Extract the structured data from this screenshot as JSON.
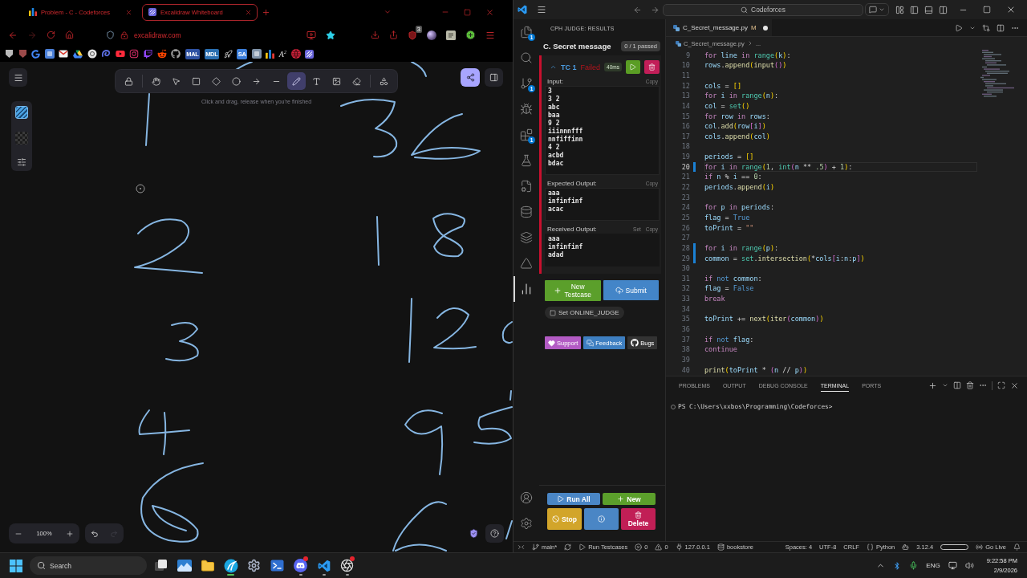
{
  "browser": {
    "tabs": [
      {
        "title": "Problem - C - Codeforces",
        "kind": "bars",
        "selected": false
      },
      {
        "title": "Excalidraw Whiteboard",
        "kind": "tile",
        "selected": true
      }
    ],
    "url": "excalidraw.com",
    "extension_badge": "3",
    "bookmarks": [
      {
        "kind": "pentagon",
        "color": "#b9b9b9"
      },
      {
        "kind": "pentagon",
        "color": "#9b4a4a"
      },
      {
        "kind": "google"
      },
      {
        "kind": "tile",
        "color": "#4a7fd8"
      },
      {
        "kind": "mail"
      },
      {
        "kind": "drive"
      },
      {
        "kind": "circle",
        "color": "#e4e4e4"
      },
      {
        "kind": "swirl",
        "color": "#5b6ee1"
      },
      {
        "kind": "youtube"
      },
      {
        "kind": "instagram"
      },
      {
        "kind": "twitch"
      },
      {
        "kind": "reddit"
      },
      {
        "kind": "github"
      },
      {
        "kind": "label",
        "color": "#2e51a2",
        "text": "MAL"
      },
      {
        "kind": "label",
        "color": "#2a6fb0",
        "text": "MDL"
      },
      {
        "kind": "rocket"
      },
      {
        "kind": "label",
        "color": "#3b7dd8",
        "text": "SA"
      },
      {
        "kind": "tile",
        "color": "#7f93a8"
      },
      {
        "kind": "bars"
      },
      {
        "kind": "glyph",
        "text": "A$^{2}$"
      },
      {
        "kind": "globe",
        "color": "#d2233c"
      },
      {
        "kind": "hatched"
      }
    ]
  },
  "whiteboard": {
    "tool_groups": [
      [
        {
          "kind": "lock",
          "selected": false
        }
      ],
      [
        {
          "kind": "hand",
          "selected": false
        },
        {
          "kind": "pointer",
          "selected": false
        },
        {
          "kind": "rectangle",
          "selected": false
        },
        {
          "kind": "diamond",
          "selected": false
        },
        {
          "kind": "ellipse",
          "selected": false
        },
        {
          "kind": "arrow",
          "selected": false
        },
        {
          "kind": "line",
          "selected": false
        },
        {
          "kind": "pencil",
          "selected": true
        },
        {
          "kind": "text",
          "selected": false
        },
        {
          "kind": "image",
          "selected": false
        },
        {
          "kind": "eraser",
          "selected": false
        }
      ],
      [
        {
          "kind": "shapes",
          "selected": false
        }
      ]
    ],
    "hint": "Click and drag, release when you're finished",
    "zoom": "100%",
    "history": [
      {
        "kind": "undo",
        "disabled": false
      },
      {
        "kind": "redo",
        "disabled": true
      }
    ]
  },
  "vscode": {
    "search": "Codeforces",
    "activity": [
      {
        "kind": "files",
        "badge": "1",
        "selected": false
      },
      {
        "kind": "search",
        "selected": false
      },
      {
        "kind": "scm",
        "badge": "1",
        "selected": false
      },
      {
        "kind": "debug",
        "selected": false
      },
      {
        "kind": "extensions",
        "badge": "1",
        "selected": false
      },
      {
        "kind": "testing",
        "selected": false
      },
      {
        "kind": "cph",
        "selected": false
      },
      {
        "kind": "database",
        "selected": false
      },
      {
        "kind": "layers",
        "selected": false
      },
      {
        "kind": "prism",
        "selected": false
      },
      {
        "kind": "chart",
        "selected": true
      }
    ],
    "cph": {
      "title": "CPH JUDGE: RESULTS",
      "problem": "C. Secret message",
      "summary": "0 / 1 passed",
      "testcases": [
        {
          "label": "TC 1",
          "status": "Failed",
          "time": "40ms",
          "failed": true,
          "expanded": true,
          "sections": [
            {
              "kind": "input",
              "title": "Input:",
              "actions": [
                "Copy"
              ],
              "lines": [
                "3",
                "3 2",
                "abc",
                "baa",
                "9 2",
                "iiinnnfff",
                "nnfiffinn",
                "4 2",
                "acbd",
                "bdac"
              ]
            },
            {
              "kind": "expected",
              "title": "Expected Output:",
              "actions": [
                "Copy"
              ],
              "lines": [
                "aaa",
                "infinfinf",
                "acac"
              ]
            },
            {
              "kind": "received",
              "title": "Received Output:",
              "actions": [
                "Set",
                "Copy"
              ],
              "lines": [
                "aaa",
                "infinfinf",
                "adad"
              ]
            }
          ]
        }
      ],
      "buttons": [
        {
          "kind": "new",
          "label": "New Testcase"
        },
        {
          "kind": "submit",
          "label": "Submit"
        }
      ],
      "online_judge": {
        "label": "Set ONLINE_JUDGE",
        "checked": false
      },
      "links": [
        {
          "kind": "support",
          "label": "Support"
        },
        {
          "kind": "feedback",
          "label": "Feedback"
        },
        {
          "kind": "bugs",
          "label": "Bugs"
        }
      ],
      "actions": [
        {
          "kind": "run-all",
          "label": "Run All"
        },
        {
          "kind": "new",
          "label": "New"
        },
        {
          "kind": "stop",
          "label": "Stop"
        },
        {
          "kind": "info"
        },
        {
          "kind": "delete",
          "label": "Delete"
        }
      ]
    },
    "editor": {
      "tab": {
        "title": "C_Secret_message.py",
        "status": "M",
        "dirty": true
      },
      "breadcrumb": {
        "file": "C_Secret_message.py",
        "rest": "..."
      },
      "lines": [
        {
          "number": "9",
          "current": false,
          "modified": false,
          "tokens": [
            {
              "text": "    for ",
              "kind": "kw"
            },
            {
              "text": "line ",
              "kind": "var"
            },
            {
              "text": "in ",
              "kind": "kw"
            },
            {
              "text": "range",
              "kind": "cls"
            },
            {
              "text": "(",
              "kind": "p1"
            },
            {
              "text": "k",
              "kind": "var"
            },
            {
              "text": ")",
              "kind": "p1"
            },
            {
              "text": ":",
              "kind": "op"
            }
          ]
        },
        {
          "number": "10",
          "current": false,
          "modified": false,
          "tokens": [
            {
              "text": "        rows",
              "kind": "var"
            },
            {
              "text": ".",
              "kind": "op"
            },
            {
              "text": "append",
              "kind": "fn"
            },
            {
              "text": "(",
              "kind": "p1"
            },
            {
              "text": "input",
              "kind": "fn"
            },
            {
              "text": "()",
              "kind": "p2"
            },
            {
              "text": ")",
              "kind": "p1"
            }
          ]
        },
        {
          "number": "11",
          "current": false,
          "modified": false
        },
        {
          "number": "12",
          "current": false,
          "modified": false,
          "tokens": [
            {
              "text": "    cols ",
              "kind": "var"
            },
            {
              "text": "= ",
              "kind": "op"
            },
            {
              "text": "[]",
              "kind": "p1"
            }
          ]
        },
        {
          "number": "13",
          "current": false,
          "modified": false,
          "tokens": [
            {
              "text": "    for ",
              "kind": "kw"
            },
            {
              "text": "i ",
              "kind": "var"
            },
            {
              "text": "in ",
              "kind": "kw"
            },
            {
              "text": "range",
              "kind": "cls"
            },
            {
              "text": "(",
              "kind": "p1"
            },
            {
              "text": "n",
              "kind": "var"
            },
            {
              "text": ")",
              "kind": "p1"
            },
            {
              "text": ":",
              "kind": "op"
            }
          ]
        },
        {
          "number": "14",
          "current": false,
          "modified": false,
          "tokens": [
            {
              "text": "        col ",
              "kind": "var"
            },
            {
              "text": "= ",
              "kind": "op"
            },
            {
              "text": "set",
              "kind": "cls"
            },
            {
              "text": "()",
              "kind": "p1"
            }
          ]
        },
        {
          "number": "15",
          "current": false,
          "modified": false,
          "tokens": [
            {
              "text": "        for ",
              "kind": "kw"
            },
            {
              "text": "row ",
              "kind": "var"
            },
            {
              "text": "in ",
              "kind": "kw"
            },
            {
              "text": "rows",
              "kind": "var"
            },
            {
              "text": ":",
              "kind": "op"
            }
          ]
        },
        {
          "number": "16",
          "current": false,
          "modified": false,
          "tokens": [
            {
              "text": "            col",
              "kind": "var"
            },
            {
              "text": ".",
              "kind": "op"
            },
            {
              "text": "add",
              "kind": "fn"
            },
            {
              "text": "(",
              "kind": "p1"
            },
            {
              "text": "row",
              "kind": "var"
            },
            {
              "text": "[",
              "kind": "p2"
            },
            {
              "text": "i",
              "kind": "var"
            },
            {
              "text": "]",
              "kind": "p2"
            },
            {
              "text": ")",
              "kind": "p1"
            }
          ]
        },
        {
          "number": "17",
          "current": false,
          "modified": false,
          "tokens": [
            {
              "text": "        cols",
              "kind": "var"
            },
            {
              "text": ".",
              "kind": "op"
            },
            {
              "text": "append",
              "kind": "fn"
            },
            {
              "text": "(",
              "kind": "p1"
            },
            {
              "text": "col",
              "kind": "var"
            },
            {
              "text": ")",
              "kind": "p1"
            }
          ]
        },
        {
          "number": "18",
          "current": false,
          "modified": false
        },
        {
          "number": "19",
          "current": false,
          "modified": false,
          "tokens": [
            {
              "text": "    periods ",
              "kind": "var"
            },
            {
              "text": "= ",
              "kind": "op"
            },
            {
              "text": "[]",
              "kind": "p1"
            }
          ]
        },
        {
          "number": "20",
          "current": true,
          "modified": true,
          "tokens": [
            {
              "text": "    for ",
              "kind": "kw"
            },
            {
              "text": "i ",
              "kind": "var"
            },
            {
              "text": "in ",
              "kind": "kw"
            },
            {
              "text": "range",
              "kind": "cls"
            },
            {
              "text": "(",
              "kind": "p1"
            },
            {
              "text": "1",
              "kind": "num"
            },
            {
              "text": ", ",
              "kind": "op"
            },
            {
              "text": "int",
              "kind": "cls"
            },
            {
              "text": "(",
              "kind": "p2"
            },
            {
              "text": "n ",
              "kind": "var"
            },
            {
              "text": "** ",
              "kind": "op"
            },
            {
              "text": ".5",
              "kind": "num"
            },
            {
              "text": ")",
              "kind": "p2"
            },
            {
              "text": " + ",
              "kind": "op"
            },
            {
              "text": "1",
              "kind": "num"
            },
            {
              "text": ")",
              "kind": "p1"
            },
            {
              "text": ":",
              "kind": "op"
            }
          ]
        },
        {
          "number": "21",
          "current": false,
          "modified": false,
          "tokens": [
            {
              "text": "        if ",
              "kind": "kw"
            },
            {
              "text": "n ",
              "kind": "var"
            },
            {
              "text": "% ",
              "kind": "op"
            },
            {
              "text": "i ",
              "kind": "var"
            },
            {
              "text": "== ",
              "kind": "op"
            },
            {
              "text": "0",
              "kind": "num"
            },
            {
              "text": ":",
              "kind": "op"
            }
          ]
        },
        {
          "number": "22",
          "current": false,
          "modified": false,
          "tokens": [
            {
              "text": "            periods",
              "kind": "var"
            },
            {
              "text": ".",
              "kind": "op"
            },
            {
              "text": "append",
              "kind": "fn"
            },
            {
              "text": "(",
              "kind": "p1"
            },
            {
              "text": "i",
              "kind": "var"
            },
            {
              "text": ")",
              "kind": "p1"
            }
          ]
        },
        {
          "number": "23",
          "current": false,
          "modified": false
        },
        {
          "number": "24",
          "current": false,
          "modified": false,
          "tokens": [
            {
              "text": "    for ",
              "kind": "kw"
            },
            {
              "text": "p ",
              "kind": "var"
            },
            {
              "text": "in ",
              "kind": "kw"
            },
            {
              "text": "periods",
              "kind": "var"
            },
            {
              "text": ":",
              "kind": "op"
            }
          ]
        },
        {
          "number": "25",
          "current": false,
          "modified": false,
          "tokens": [
            {
              "text": "        flag ",
              "kind": "var"
            },
            {
              "text": "= ",
              "kind": "op"
            },
            {
              "text": "True",
              "kind": "const"
            }
          ]
        },
        {
          "number": "26",
          "current": false,
          "modified": false,
          "tokens": [
            {
              "text": "        toPrint ",
              "kind": "var"
            },
            {
              "text": "= ",
              "kind": "op"
            },
            {
              "text": "\"\"",
              "kind": "str"
            }
          ]
        },
        {
          "number": "27",
          "current": false,
          "modified": false
        },
        {
          "number": "28",
          "current": false,
          "modified": true,
          "tokens": [
            {
              "text": "        for ",
              "kind": "kw"
            },
            {
              "text": "i ",
              "kind": "var"
            },
            {
              "text": "in ",
              "kind": "kw"
            },
            {
              "text": "range",
              "kind": "cls"
            },
            {
              "text": "(",
              "kind": "p1"
            },
            {
              "text": "p",
              "kind": "var"
            },
            {
              "text": ")",
              "kind": "p1"
            },
            {
              "text": ":",
              "kind": "op"
            }
          ]
        },
        {
          "number": "29",
          "current": false,
          "modified": true,
          "tokens": [
            {
              "text": "            common ",
              "kind": "var"
            },
            {
              "text": "= ",
              "kind": "op"
            },
            {
              "text": "set",
              "kind": "cls"
            },
            {
              "text": ".",
              "kind": "op"
            },
            {
              "text": "intersection",
              "kind": "fn"
            },
            {
              "text": "(",
              "kind": "p1"
            },
            {
              "text": "*",
              "kind": "op"
            },
            {
              "text": "cols",
              "kind": "var"
            },
            {
              "text": "[",
              "kind": "p2"
            },
            {
              "text": "i",
              "kind": "var"
            },
            {
              "text": ":",
              "kind": "op"
            },
            {
              "text": "n",
              "kind": "var"
            },
            {
              "text": ":",
              "kind": "op"
            },
            {
              "text": "p",
              "kind": "var"
            },
            {
              "text": "]",
              "kind": "p2"
            },
            {
              "text": ")",
              "kind": "p1"
            }
          ]
        },
        {
          "number": "30",
          "current": false,
          "modified": false
        },
        {
          "number": "31",
          "current": false,
          "modified": false,
          "tokens": [
            {
              "text": "            if ",
              "kind": "kw"
            },
            {
              "text": "not ",
              "kind": "not"
            },
            {
              "text": "common",
              "kind": "var"
            },
            {
              "text": ":",
              "kind": "op"
            }
          ]
        },
        {
          "number": "32",
          "current": false,
          "modified": false,
          "tokens": [
            {
              "text": "                flag ",
              "kind": "var"
            },
            {
              "text": "= ",
              "kind": "op"
            },
            {
              "text": "False",
              "kind": "const"
            }
          ]
        },
        {
          "number": "33",
          "current": false,
          "modified": false,
          "tokens": [
            {
              "text": "                break",
              "kind": "kw"
            }
          ]
        },
        {
          "number": "34",
          "current": false,
          "modified": false
        },
        {
          "number": "35",
          "current": false,
          "modified": false,
          "tokens": [
            {
              "text": "            toPrint ",
              "kind": "var"
            },
            {
              "text": "+= ",
              "kind": "op"
            },
            {
              "text": "next",
              "kind": "fn"
            },
            {
              "text": "(",
              "kind": "p1"
            },
            {
              "text": "iter",
              "kind": "fn"
            },
            {
              "text": "(",
              "kind": "p2"
            },
            {
              "text": "common",
              "kind": "var"
            },
            {
              "text": ")",
              "kind": "p2"
            },
            {
              "text": ")",
              "kind": "p1"
            }
          ]
        },
        {
          "number": "36",
          "current": false,
          "modified": false
        },
        {
          "number": "37",
          "current": false,
          "modified": false,
          "tokens": [
            {
              "text": "        if ",
              "kind": "kw"
            },
            {
              "text": "not ",
              "kind": "not"
            },
            {
              "text": "flag",
              "kind": "var"
            },
            {
              "text": ":",
              "kind": "op"
            }
          ]
        },
        {
          "number": "38",
          "current": false,
          "modified": false,
          "tokens": [
            {
              "text": "            continue",
              "kind": "kw"
            }
          ]
        },
        {
          "number": "39",
          "current": false,
          "modified": false
        },
        {
          "number": "40",
          "current": false,
          "modified": false,
          "tokens": [
            {
              "text": "        print",
              "kind": "fn"
            },
            {
              "text": "(",
              "kind": "p1"
            },
            {
              "text": "toPrint ",
              "kind": "var"
            },
            {
              "text": "* ",
              "kind": "op"
            },
            {
              "text": "(",
              "kind": "p2"
            },
            {
              "text": "n ",
              "kind": "var"
            },
            {
              "text": "// ",
              "kind": "op"
            },
            {
              "text": "p",
              "kind": "var"
            },
            {
              "text": ")",
              "kind": "p2"
            },
            {
              "text": ")",
              "kind": "p1"
            }
          ]
        }
      ]
    },
    "panel": {
      "tabs": [
        {
          "label": "PROBLEMS",
          "selected": false
        },
        {
          "label": "OUTPUT",
          "selected": false
        },
        {
          "label": "DEBUG CONSOLE",
          "selected": false
        },
        {
          "label": "TERMINAL",
          "selected": true
        },
        {
          "label": "PORTS",
          "selected": false
        }
      ],
      "prompt": "PS C:\\Users\\xxbos\\Programming\\Codeforces>"
    },
    "status_left": [
      {
        "kind": "remote"
      },
      {
        "kind": "branch",
        "text": "main*"
      },
      {
        "kind": "sync"
      },
      {
        "kind": "run",
        "text": "Run Testcases"
      },
      {
        "kind": "errors",
        "text": "0"
      },
      {
        "kind": "warnings",
        "text": "0"
      },
      {
        "kind": "server",
        "text": "127.0.0.1"
      },
      {
        "kind": "database",
        "text": "bookstore"
      }
    ],
    "status_right": [
      {
        "kind": "plain",
        "text": "Spaces: 4"
      },
      {
        "kind": "plain",
        "text": "UTF-8"
      },
      {
        "kind": "plain",
        "text": "CRLF"
      },
      {
        "kind": "language",
        "text": "Python"
      },
      {
        "kind": "copilot"
      },
      {
        "kind": "plain",
        "text": "3.12.4"
      },
      {
        "kind": "meter"
      },
      {
        "kind": "live",
        "text": "Go Live"
      },
      {
        "kind": "bell"
      }
    ]
  },
  "taskbar": {
    "search": {
      "placeholder": "Search"
    },
    "apps": [
      {
        "kind": "taskview",
        "running": false,
        "selected": false,
        "alert": false
      },
      {
        "kind": "photos",
        "running": false,
        "selected": false,
        "alert": false
      },
      {
        "kind": "files",
        "running": false,
        "selected": false,
        "alert": false
      },
      {
        "kind": "browser",
        "running": true,
        "selected": true,
        "alert": false
      },
      {
        "kind": "settings",
        "running": false,
        "selected": false,
        "alert": false
      },
      {
        "kind": "terminal",
        "running": false,
        "selected": false,
        "alert": false
      },
      {
        "kind": "discord",
        "running": true,
        "selected": false,
        "alert": true
      },
      {
        "kind": "code",
        "running": true,
        "selected": false,
        "alert": false
      },
      {
        "kind": "obs",
        "running": true,
        "selected": false,
        "alert": true
      }
    ],
    "language": "ENG",
    "time": "9:22:58 PM",
    "date": "2/9/2026"
  }
}
